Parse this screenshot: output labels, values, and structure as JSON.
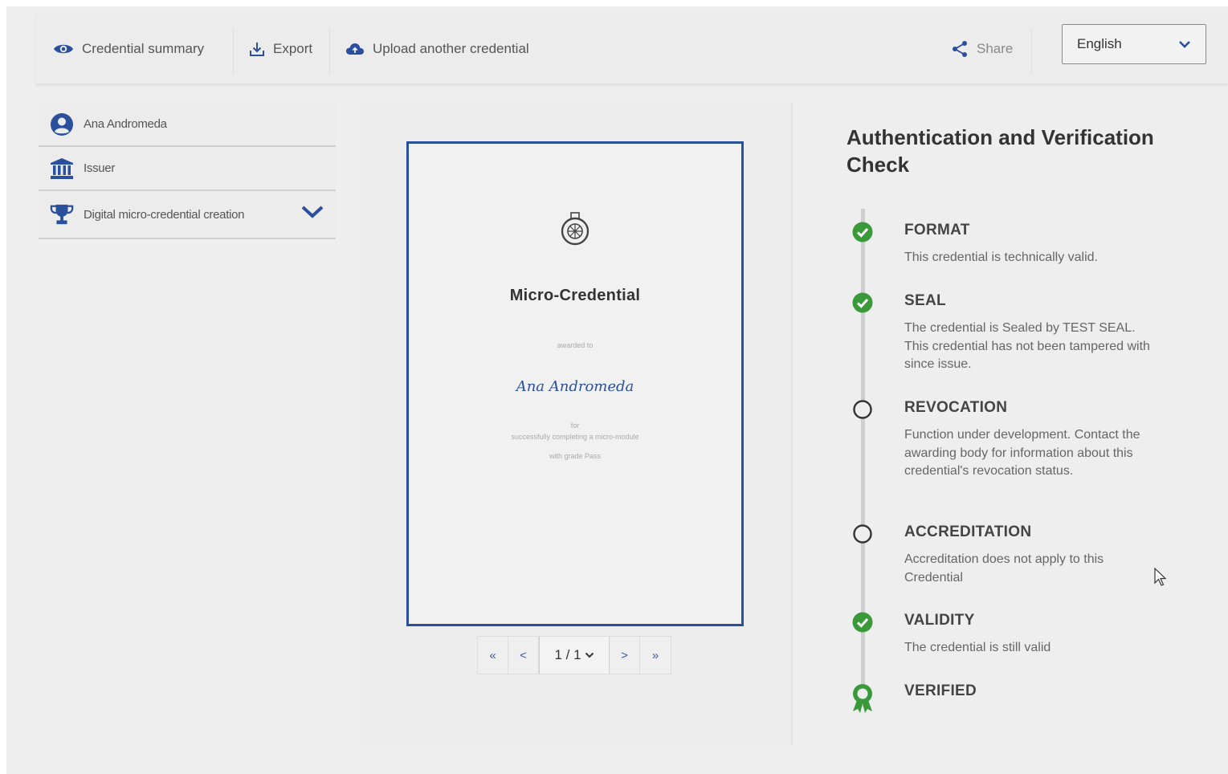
{
  "toolbar": {
    "credential_summary": "Credential summary",
    "export": "Export",
    "upload": "Upload another credential",
    "share": "Share",
    "language": "English"
  },
  "nav": {
    "items": [
      {
        "label": "Ana Andromeda",
        "icon": "user-circle-icon"
      },
      {
        "label": "Issuer",
        "icon": "institution-icon"
      },
      {
        "label": "Digital micro-credential creation",
        "icon": "trophy-icon"
      }
    ]
  },
  "document": {
    "title": "Micro-Credential",
    "awarded_to": "awarded to",
    "recipient": "Ana Andromeda",
    "for": "for",
    "completion": "successfully completing a micro-module",
    "grade": "with grade Pass"
  },
  "pager": {
    "first": "«",
    "prev": "<",
    "page": "1 / 1",
    "next": ">",
    "last": "»"
  },
  "verification": {
    "title": "Authentication and Verification Check",
    "checks": [
      {
        "name": "FORMAT",
        "status": "passed",
        "desc": "This credential is technically valid."
      },
      {
        "name": "SEAL",
        "status": "passed",
        "desc": "The credential is Sealed by TEST SEAL. This credential has not been tampered with since issue."
      },
      {
        "name": "REVOCATION",
        "status": "not-applicable",
        "desc": "Function under development. Contact the awarding body for information about this credential's revocation status."
      },
      {
        "name": "ACCREDITATION",
        "status": "not-applicable",
        "desc": "Accreditation does not apply to this Credential"
      },
      {
        "name": "VALIDITY",
        "status": "passed",
        "desc": "The credential is still valid"
      },
      {
        "name": "VERIFIED",
        "status": "verified",
        "desc": ""
      }
    ]
  },
  "colors": {
    "brand_blue": "#2a4f9c",
    "success_green": "#3a9a3a",
    "background": "#eeeeee"
  }
}
